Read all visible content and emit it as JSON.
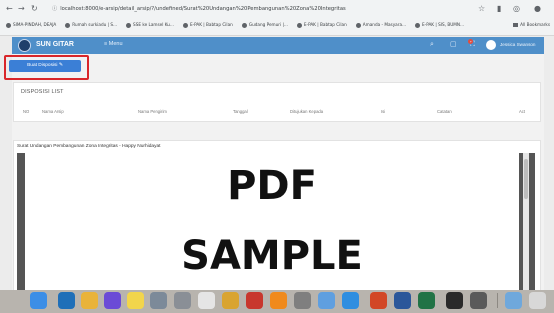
{
  "browser": {
    "url": "localhost:8000/e-arsip/detail_arsip/?/undefined/Surat%20Undangan%20Pembangunan%20Zona%20Integritas",
    "bookmarks": [
      "SIMA-PINDAH, DEAJA",
      "Rumah surkiadu | S...",
      "SSE ke Lamsel Ku...",
      "E-PAK | Babtap Cilan",
      "Gudang Pemuri |...",
      "E-PAK | Babtap Cilan",
      "Amanda - Masyara...",
      "E-PAK | SIS, BUMN..."
    ],
    "bookmarks_right": "All Bookmarks"
  },
  "app": {
    "brand": "SUN GITAR",
    "menu": "Menu",
    "user": "Jessica Swanson"
  },
  "actions": {
    "disposisi_button": "Buat Disposisi"
  },
  "disposisi": {
    "title": "DISPOSISI LIST",
    "columns": [
      "NO",
      "Nama Arsip",
      "Nama Pengirim",
      "Tanggal",
      "Ditujukan Kepada",
      "Isi",
      "Catatan",
      "Act"
    ]
  },
  "document": {
    "title": "Surat Undangan Pembangunan Zona Integritas - Happy Nurhidayat",
    "pdf_line1": "PDF",
    "pdf_line2": "SAMPLE"
  },
  "colors": {
    "appbar": "#4f8fc9",
    "button": "#3b7fd6",
    "highlight": "#d9262a"
  },
  "dock": [
    {
      "name": "finder-icon",
      "color": "#3c8ee6"
    },
    {
      "name": "vscode-icon",
      "color": "#1f6fb8"
    },
    {
      "name": "chrome-icon",
      "color": "#e9b33a"
    },
    {
      "name": "siri-icon",
      "color": "#6b4bd6"
    },
    {
      "name": "notes-icon",
      "color": "#f2d54b"
    },
    {
      "name": "launchpad-icon",
      "color": "#7c8a99"
    },
    {
      "name": "system-icon",
      "color": "#8a8f96"
    },
    {
      "name": "photos-icon",
      "color": "#e5e5e5"
    },
    {
      "name": "stack-icon",
      "color": "#d9a431"
    },
    {
      "name": "filezilla-icon",
      "color": "#c8372d"
    },
    {
      "name": "vlc-icon",
      "color": "#f08a1c"
    },
    {
      "name": "settings-icon",
      "color": "#7f7f7f"
    },
    {
      "name": "preview-icon",
      "color": "#5f9fe0"
    },
    {
      "name": "safari-icon",
      "color": "#2f8ee0"
    },
    {
      "name": "powerpoint-icon",
      "color": "#d24726"
    },
    {
      "name": "word-icon",
      "color": "#2b579a"
    },
    {
      "name": "excel-icon",
      "color": "#217346"
    },
    {
      "name": "terminal-icon",
      "color": "#2a2a2a"
    },
    {
      "name": "app-icon",
      "color": "#5a5a5a"
    },
    {
      "name": "downloads-icon",
      "color": "#6fa8dc"
    },
    {
      "name": "trash-icon",
      "color": "#d8d8d8"
    }
  ]
}
